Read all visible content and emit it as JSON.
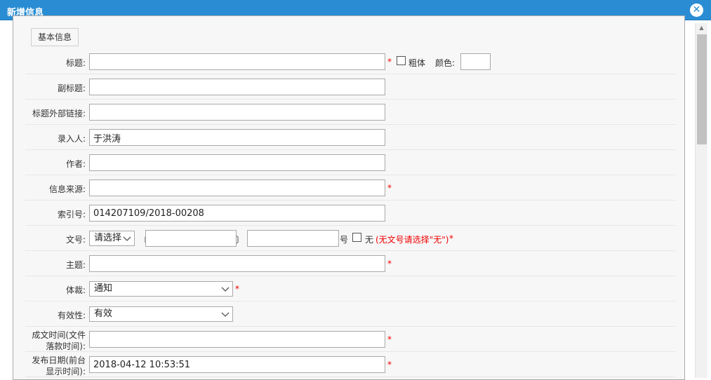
{
  "window": {
    "title": "新增信息",
    "close_label": "✕"
  },
  "fieldset": {
    "legend": "基本信息"
  },
  "fields": {
    "title": {
      "label": "标题:",
      "value": "",
      "required": "*",
      "bold_label": "粗体",
      "color_label": "颜色:"
    },
    "subtitle": {
      "label": "副标题:",
      "value": ""
    },
    "external_link": {
      "label": "标题外部链接:",
      "value": ""
    },
    "entered_by": {
      "label": "录入人:",
      "value": "于洪涛"
    },
    "author": {
      "label": "作者:",
      "value": ""
    },
    "source": {
      "label": "信息来源:",
      "value": "",
      "required": "*"
    },
    "index_no": {
      "label": "索引号:",
      "value": "014207109/2018-00208"
    },
    "doc_no": {
      "label": "文号:",
      "select_value": "请选择",
      "bracket_open": "〔",
      "bracket_close": "〕",
      "year": "",
      "number": "",
      "hao": "号",
      "none_label": "无",
      "hint": "(无文号请选择\"无\")",
      "required": "*"
    },
    "subject": {
      "label": "主题:",
      "value": "",
      "required": "*"
    },
    "genre": {
      "label": "体裁:",
      "select_value": "通知",
      "required": "*"
    },
    "validity": {
      "label": "有效性:",
      "select_value": "有效"
    },
    "written_time": {
      "label_line1": "成文时间(文件",
      "label_line2": "落款时间):",
      "value": "",
      "required": "*"
    },
    "publish_date": {
      "label_line1": "发布日期(前台",
      "label_line2": "显示时间):",
      "value": "2018-04-12 10:53:51",
      "required": "*"
    }
  },
  "colors": {
    "titlebar": "#2a8dd4",
    "required": "#e00000"
  }
}
